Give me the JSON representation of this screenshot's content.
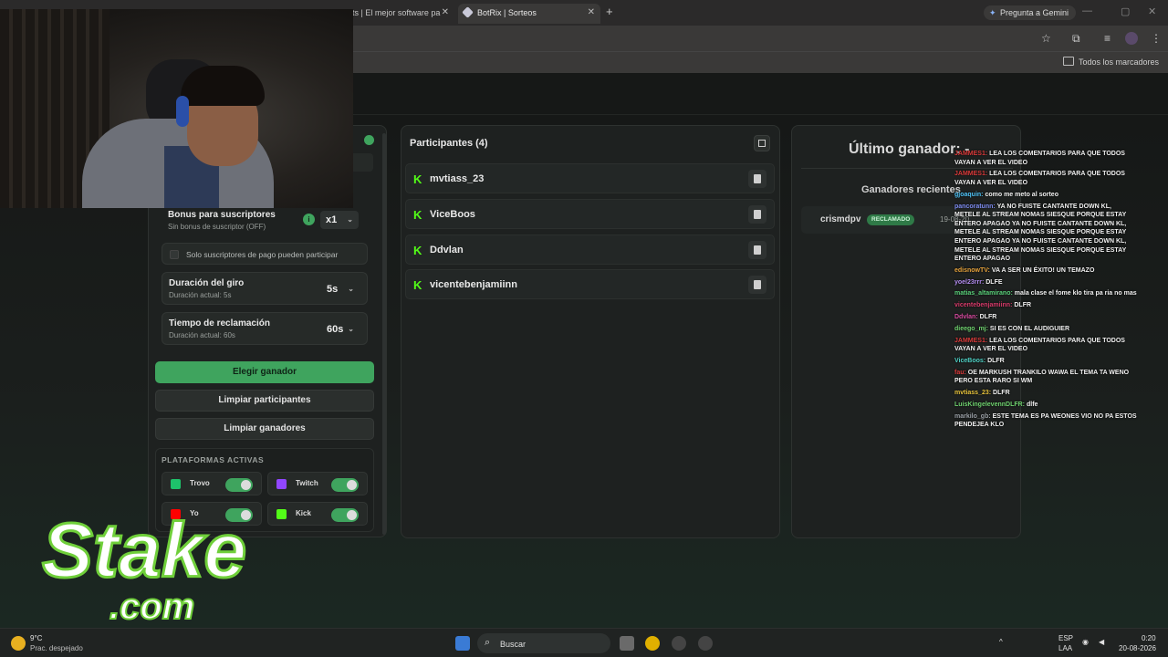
{
  "browser": {
    "tabs": [
      {
        "label": "ts | El mejor software pa"
      },
      {
        "label": "BotRix | Sorteos"
      }
    ],
    "gemini_label": "Pregunta a Gemini",
    "bookmarks_label": "Todos los marcadores"
  },
  "config": {
    "bonus": {
      "title": "Bonus para suscriptores",
      "subtitle": "Sin bonus de suscriptor (OFF)",
      "value": "x1"
    },
    "subs_only": "Solo suscriptores de pago pueden participar",
    "spin": {
      "title": "Duración del giro",
      "subtitle": "Duración actual: 5s",
      "value": "5s"
    },
    "claim": {
      "title": "Tiempo de reclamación",
      "subtitle": "Duración actual: 60s",
      "value": "60s"
    },
    "buttons": {
      "pick": "Elegir ganador",
      "clear_participants": "Limpiar participantes",
      "clear_winners": "Limpiar ganadores"
    },
    "platforms_title": "PLATAFORMAS ACTIVAS",
    "platforms": [
      {
        "name": "Trovo",
        "enabled": true,
        "color": "#1ec26b"
      },
      {
        "name": "Twitch",
        "enabled": true,
        "color": "#9146ff"
      },
      {
        "name": "Yo",
        "enabled": true,
        "color": "#ff0000"
      },
      {
        "name": "Kick",
        "enabled": true,
        "color": "#53fc18"
      }
    ]
  },
  "participants": {
    "title": "Participantes (4)",
    "list": [
      "mvtiass_23",
      "ViceBoos",
      "Ddvlan",
      "vicentebenjamiinn"
    ]
  },
  "winner": {
    "title": "Último ganador: -",
    "recent_title": "Ganadores recientes",
    "recent": [
      {
        "name": "crismdpv",
        "badge": "RECLAMADO",
        "date": "19-08-20"
      }
    ]
  },
  "chat": [
    {
      "user": "JAMMES1:",
      "color": "#d83a3a",
      "msg": "LEA LOS COMENTARIOS PARA QUE TODOS VAYAN A VER EL VIDEO"
    },
    {
      "user": "JAMMES1:",
      "color": "#d83a3a",
      "msg": "LEA LOS COMENTARIOS PARA QUE TODOS VAYAN A VER EL VIDEO"
    },
    {
      "user": "gjoaquin:",
      "color": "#4fc3f7",
      "msg": "como me meto al sorteo"
    },
    {
      "user": "pancoratunn:",
      "color": "#7e8cf0",
      "msg": "YA NO FUISTE CANTANTE DOWN KL, METELE AL STREAM NOMAS SIESQUE PORQUE ESTAY ENTERO APAGAO YA NO FUISTE CANTANTE DOWN KL, METELE AL STREAM NOMAS SIESQUE PORQUE ESTAY ENTERO APAGAO YA NO FUISTE CANTANTE DOWN KL, METELE AL STREAM NOMAS SIESQUE PORQUE ESTAY ENTERO APAGAO"
    },
    {
      "user": "edisnowTV:",
      "color": "#e6a23c",
      "msg": "VA A SER UN ÉXITO! UN TEMAZO"
    },
    {
      "user": "yoel23rrr:",
      "color": "#b38cf0",
      "msg": "DLFE"
    },
    {
      "user": "matias_altamirano:",
      "color": "#5ad17a",
      "msg": "mala clase el fome klo tira pa ria no mas"
    },
    {
      "user": "vicentebenjamiinn:",
      "color": "#d83a6a",
      "msg": "DLFR"
    },
    {
      "user": "Ddvlan:",
      "color": "#d84aa0",
      "msg": "DLFR"
    },
    {
      "user": "dieego_mj:",
      "color": "#6fd16f",
      "msg": "SI ES CON EL AUDIGUIER"
    },
    {
      "user": "JAMMES1:",
      "color": "#d83a3a",
      "msg": "LEA LOS COMENTARIOS PARA QUE TODOS VAYAN A VER EL VIDEO"
    },
    {
      "user": "ViceBoos:",
      "color": "#4fd1c5",
      "msg": "DLFR"
    },
    {
      "user": "fau:",
      "color": "#d83a3a",
      "msg": "OE MARKUSH TRANKILO WAWA EL TEMA TA WENO PERO ESTA RARO SI WM"
    },
    {
      "user": "mvtiass_23:",
      "color": "#e6c23c",
      "msg": "DLFR"
    },
    {
      "user": "LuisKingelevennDLFR:",
      "color": "#6fd16f",
      "msg": "dlfe"
    },
    {
      "user": "markilo_gb:",
      "color": "#9aa0a6",
      "msg": "ESTE TEMA ES PA WEONES VIO NO PA ESTOS PENDEJEA KLO"
    }
  ],
  "taskbar": {
    "weather_temp": "9°C",
    "weather_desc": "Prac. despejado",
    "search": "Buscar",
    "lang": "ESP",
    "lang2": "LAA",
    "time": "0:20",
    "date": "20-08-2026"
  },
  "logo_text": "Stake.com"
}
